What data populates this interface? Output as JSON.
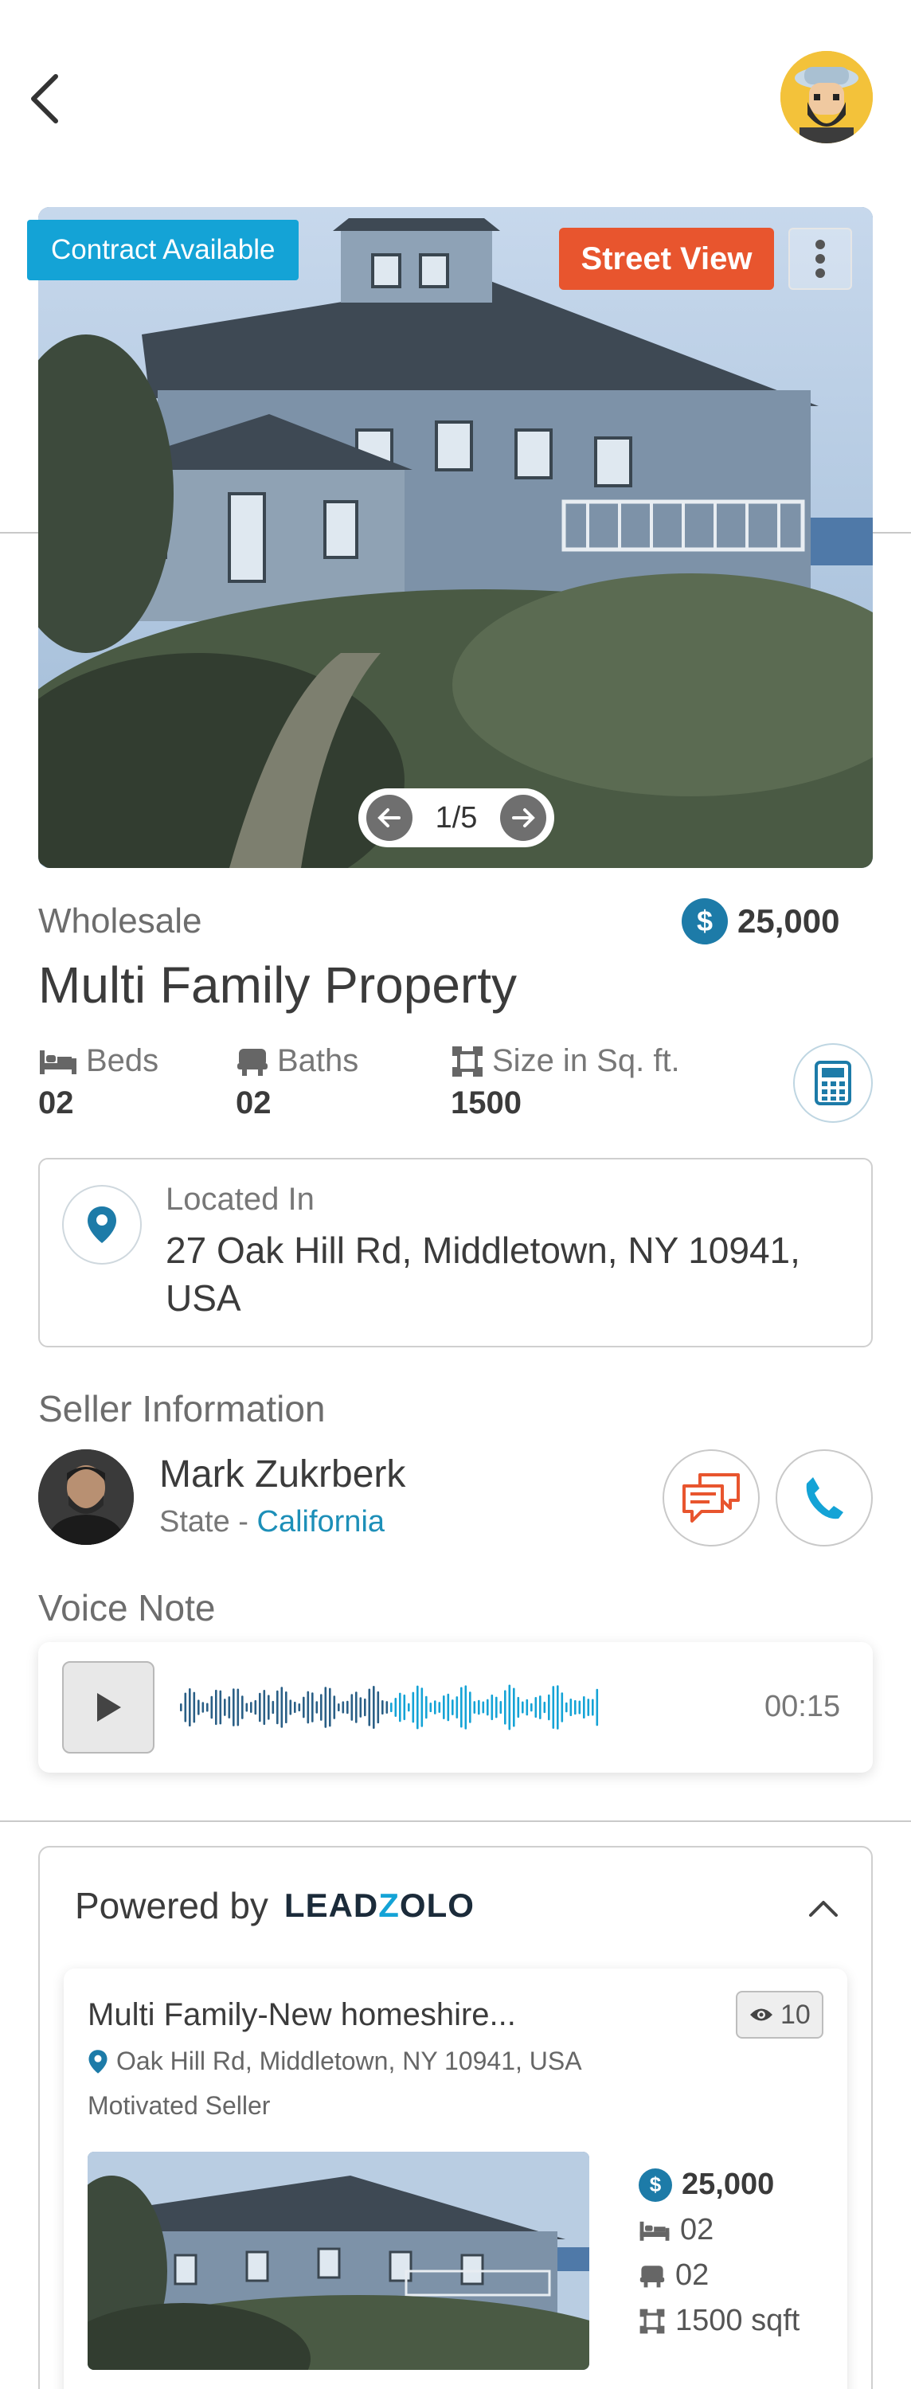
{
  "hero": {
    "badge": "Contract Available",
    "street_view": "Street View",
    "pager": "1/5"
  },
  "property": {
    "deal_type": "Wholesale",
    "price": "25,000",
    "title": "Multi Family Property",
    "specs": [
      {
        "label": "Beds",
        "value": "02",
        "icon": "bed-icon"
      },
      {
        "label": "Baths",
        "value": "02",
        "icon": "bath-icon"
      },
      {
        "label": "Size in Sq. ft.",
        "value": "1500",
        "icon": "area-icon"
      }
    ]
  },
  "location": {
    "label": "Located In",
    "address": "27 Oak Hill Rd, Middletown, NY 10941, USA"
  },
  "seller": {
    "section_title": "Seller Information",
    "name": "Mark Zukrberk",
    "state_prefix": "State - ",
    "state": "California"
  },
  "voice": {
    "section_title": "Voice Note",
    "duration": "00:15"
  },
  "powered": {
    "prefix": "Powered by",
    "brand_part1": "LEAD",
    "brand_part2": "Z",
    "brand_part3": "OLO"
  },
  "listing": {
    "title": "Multi Family-New homeshire...",
    "views": "10",
    "address": "Oak Hill Rd, Middletown, NY 10941, USA",
    "tag": "Motivated Seller",
    "price": "25,000",
    "beds": "02",
    "baths": "02",
    "size": "1500 sqft"
  },
  "colors": {
    "accent_blue": "#14a3d6",
    "street_view_orange": "#e8552e",
    "dollar_blue": "#1d7ba8",
    "state_link": "#1d8fb8"
  }
}
